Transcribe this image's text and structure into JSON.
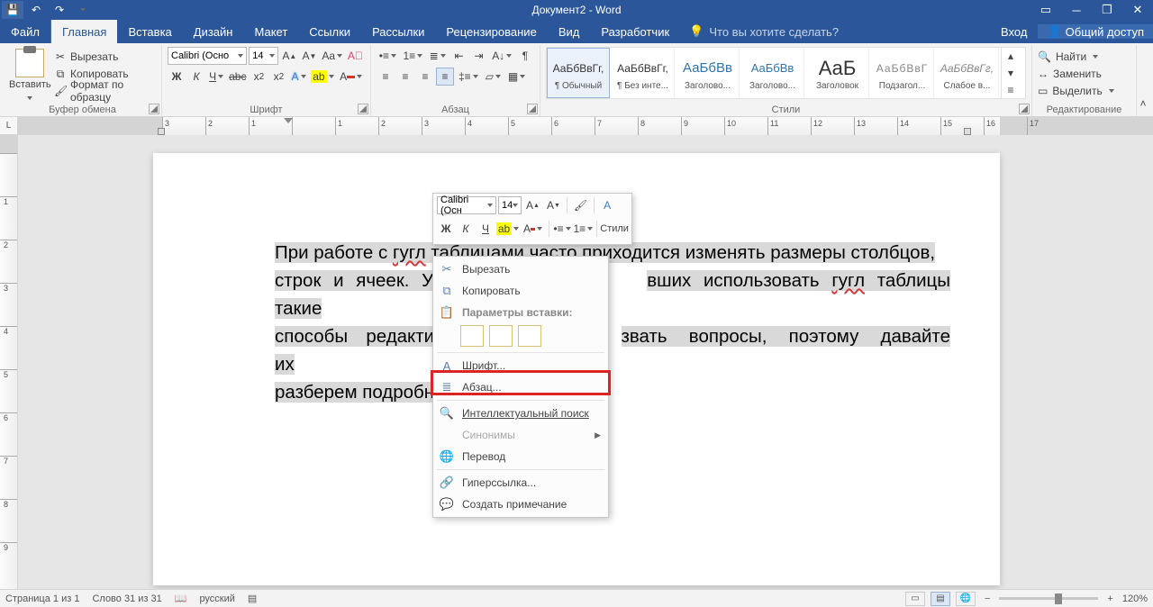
{
  "title": "Документ2 - Word",
  "qat": {
    "save": "💾",
    "undo": "↶",
    "redo": "↷"
  },
  "tabs": {
    "file": "Файл",
    "home": "Главная",
    "insert": "Вставка",
    "design": "Дизайн",
    "layout": "Макет",
    "references": "Ссылки",
    "mailings": "Рассылки",
    "review": "Рецензирование",
    "view": "Вид",
    "developer": "Разработчик"
  },
  "tellme": "Что вы хотите сделать?",
  "signin": "Вход",
  "share": "Общий доступ",
  "clipboard": {
    "paste": "Вставить",
    "cut": "Вырезать",
    "copy": "Копировать",
    "format": "Формат по образцу",
    "group": "Буфер обмена"
  },
  "font": {
    "name": "Calibri (Осно",
    "size": "14",
    "group": "Шрифт"
  },
  "paragraph": {
    "group": "Абзац"
  },
  "styles": {
    "group": "Стили",
    "items": [
      {
        "preview": "АаБбВвГг,",
        "name": "¶ Обычный",
        "sel": true,
        "cls": ""
      },
      {
        "preview": "АаБбВвГг,",
        "name": "¶ Без инте...",
        "cls": ""
      },
      {
        "preview": "АаБбВв",
        "name": "Заголово...",
        "cls": "c-blue"
      },
      {
        "preview": "АаБбВв",
        "name": "Заголово...",
        "cls": "c-blue2"
      },
      {
        "preview": "АаБ",
        "name": "Заголовок",
        "cls": "c-big"
      },
      {
        "preview": "АаБбВвГ",
        "name": "Подзагол...",
        "cls": "c-gray"
      },
      {
        "preview": "АаБбВвГг,",
        "name": "Слабое в...",
        "cls": "c-ital"
      }
    ]
  },
  "editing": {
    "find": "Найти",
    "replace": "Заменить",
    "select": "Выделить",
    "group": "Редактирование"
  },
  "ruler_nums": [
    "3",
    "2",
    "1",
    "",
    "1",
    "2",
    "3",
    "4",
    "5",
    "6",
    "7",
    "8",
    "9",
    "10",
    "11",
    "12",
    "13",
    "14",
    "15",
    "16",
    "17"
  ],
  "doc_text": {
    "l1a": "При работе с ",
    "l1b": "гугл",
    "l1c": " таблицами часто приходится изменять размеры столбцов,",
    "l2a": "строк и ячеек. У лю",
    "l2b": "вших использовать ",
    "l2c": "гугл",
    "l2d": " таблицы такие",
    "l3a": "способы  редактир",
    "l3b": "звать вопросы, поэтому давайте их",
    "l4": "разберем подробн"
  },
  "mini": {
    "font": "Calibri (Осн",
    "size": "14",
    "styles": "Стили"
  },
  "ctx": {
    "cut": "Вырезать",
    "copy": "Копировать",
    "paste_hdr": "Параметры вставки:",
    "font": "Шрифт...",
    "para": "Абзац...",
    "smart": "Интеллектуальный поиск",
    "syn": "Синонимы",
    "trans": "Перевод",
    "link": "Гиперссылка...",
    "comment": "Создать примечание"
  },
  "status": {
    "page": "Страница 1 из 1",
    "words": "Слово 31 из 31",
    "lang": "русский",
    "zoom": "120%"
  }
}
